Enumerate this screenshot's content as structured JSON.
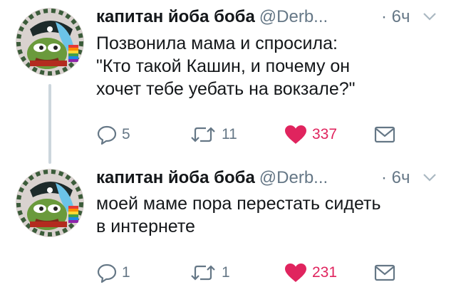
{
  "tweets": [
    {
      "name": "капитан йоба боба",
      "handle": "@Derb...",
      "time": "· 6ч",
      "text": "Позвонила мама и спросила:\n\"Кто такой Кашин, и почему он\nхочет тебе уебать на вокзале?\"",
      "replies": "5",
      "retweets": "11",
      "likes": "337"
    },
    {
      "name": "капитан йоба боба",
      "handle": "@Derb...",
      "time": "· 6ч",
      "text": "моей маме пора перестать сидеть\nв интернете",
      "replies": "1",
      "retweets": "1",
      "likes": "231"
    }
  ],
  "icons": {
    "reply": "reply-icon",
    "retweet": "retweet-icon",
    "like": "heart-icon",
    "message": "envelope-icon",
    "menu": "chevron-down-icon"
  },
  "colors": {
    "text": "#14171a",
    "muted": "#657786",
    "like": "#e0245e",
    "thread_line": "#ccd6dd"
  }
}
